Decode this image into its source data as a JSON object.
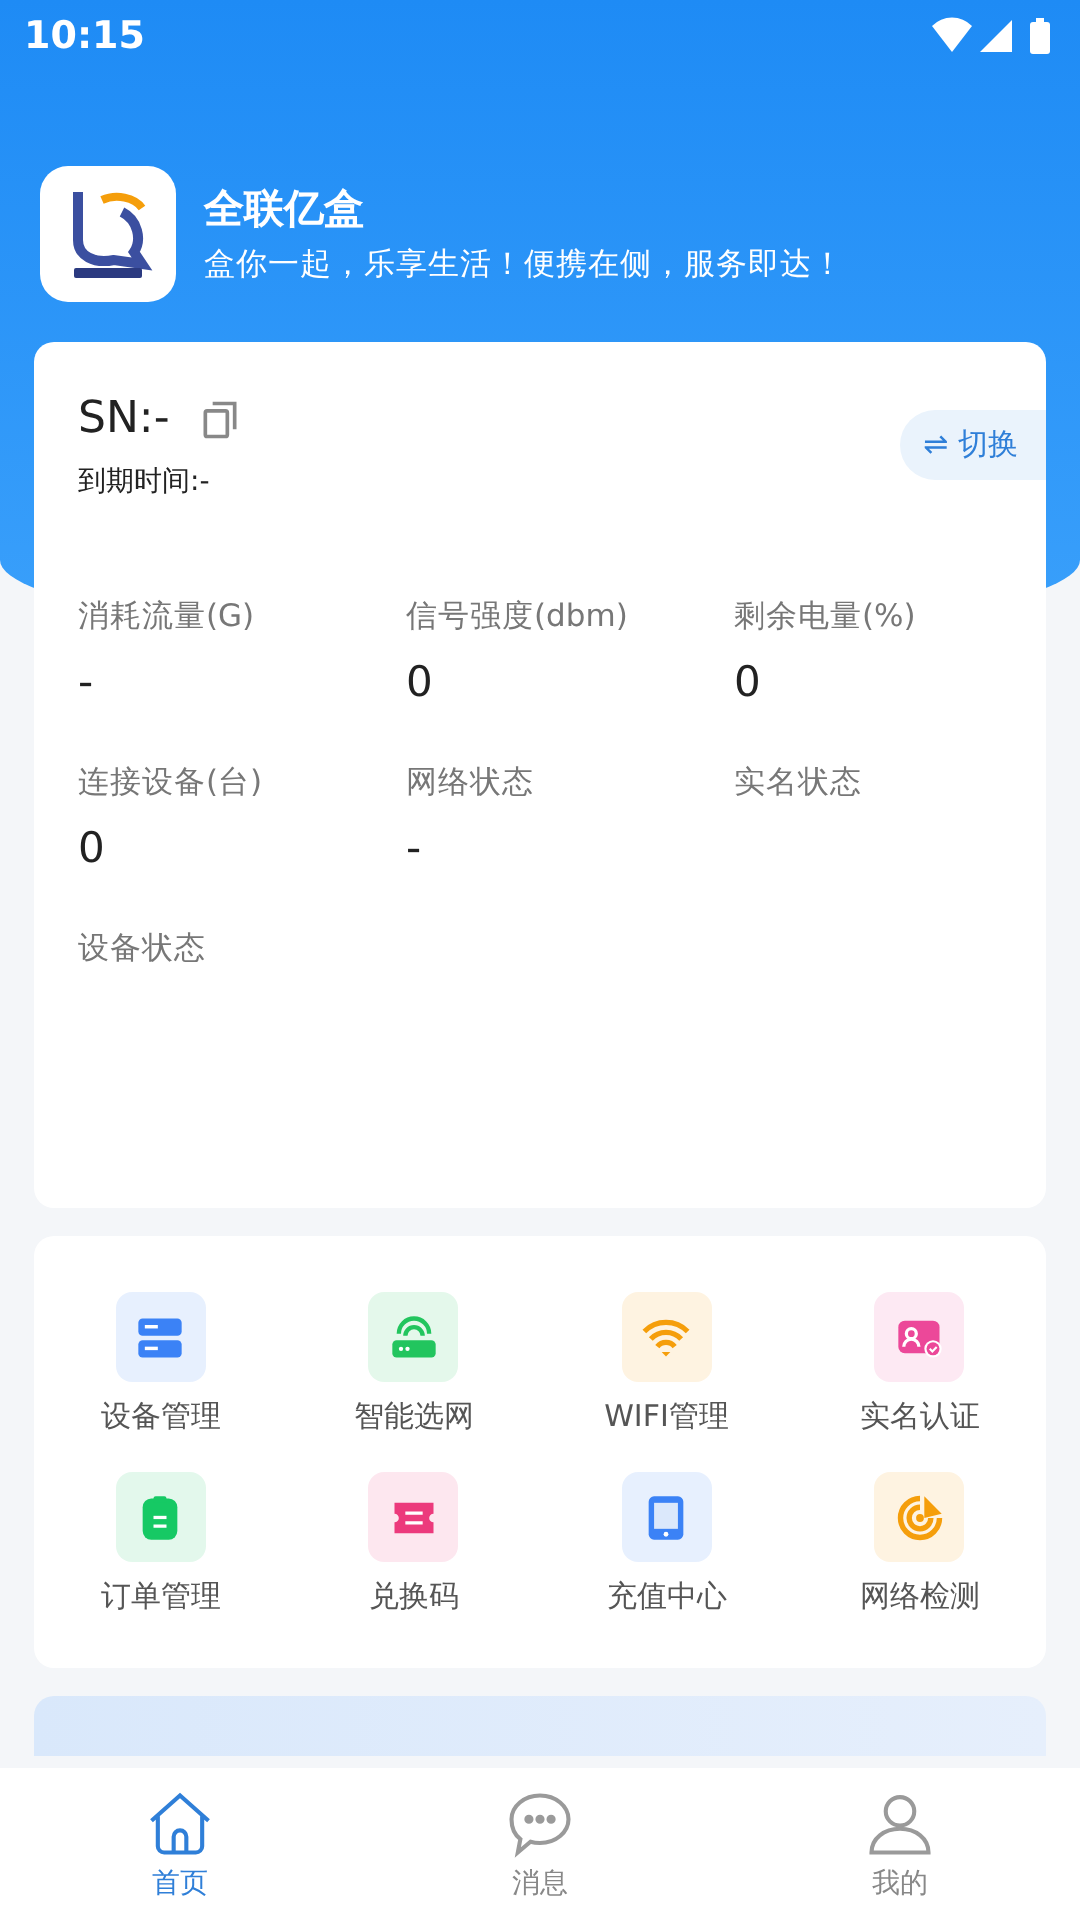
{
  "status_bar": {
    "time": "10:15"
  },
  "app": {
    "name": "全联亿盒",
    "slogan": "盒你一起，乐享生活！便携在侧，服务即达！"
  },
  "device_card": {
    "sn": "SN:-",
    "expiry": "到期时间:-",
    "switch_button": "⇌ 切换",
    "stats": [
      {
        "label": "消耗流量(G)",
        "value": "-"
      },
      {
        "label": "信号强度(dbm)",
        "value": "0"
      },
      {
        "label": "剩余电量(%)",
        "value": "0"
      },
      {
        "label": "连接设备(台)",
        "value": "0"
      },
      {
        "label": "网络状态",
        "value": "-"
      },
      {
        "label": "实名状态"
      },
      {
        "label": "设备状态"
      }
    ]
  },
  "menu": [
    {
      "label": "设备管理",
      "kind": "server",
      "color": "#3b82f6"
    },
    {
      "label": "智能选网",
      "kind": "router",
      "color": "#22c55e"
    },
    {
      "label": "WIFI管理",
      "kind": "wifi",
      "color": "#f59e0b"
    },
    {
      "label": "实名认证",
      "kind": "idcard",
      "color": "#ec4899"
    },
    {
      "label": "订单管理",
      "kind": "clipboard",
      "color": "#16c964"
    },
    {
      "label": "兑换码",
      "kind": "ticket",
      "color": "#ec3a7c"
    },
    {
      "label": "充值中心",
      "kind": "phone",
      "color": "#3b82f6"
    },
    {
      "label": "网络检测",
      "kind": "radar",
      "color": "#f59e0b"
    }
  ],
  "bottom_nav": [
    {
      "label": "首页",
      "kind": "home",
      "selected": true
    },
    {
      "label": "消息",
      "kind": "chat",
      "selected": false
    },
    {
      "label": "我的",
      "kind": "user",
      "selected": false
    }
  ]
}
